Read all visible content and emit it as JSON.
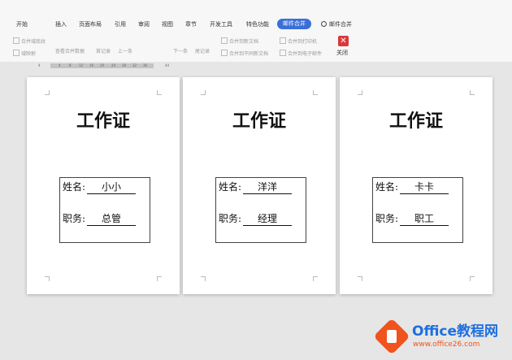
{
  "menu": {
    "items": [
      "开始",
      "插入",
      "页面布局",
      "引用",
      "审阅",
      "视图",
      "章节",
      "开发工具",
      "特色功能"
    ],
    "active": "邮件合并",
    "search": "邮件合并"
  },
  "toolbar": {
    "btn1": "合并域底纹",
    "btn2": "域映射",
    "btn3": "查看合并数据",
    "btn4": "首记录",
    "btn5": "上一条",
    "btn6": "下一条",
    "btn7": "尾记录",
    "btn8": "合并到新文档",
    "btn9": "合并到不同新文档",
    "btn10": "合并到打印机",
    "btn11": "合并到电子邮件",
    "close": "关闭",
    "close_glyph": "✕"
  },
  "ruler": {
    "ticks": [
      "4",
      "4",
      "8",
      "12",
      "16",
      "20",
      "24",
      "28",
      "32",
      "36",
      "44"
    ]
  },
  "cards": [
    {
      "title": "工作证",
      "name_label": "姓名:",
      "name": "小小",
      "job_label": "职务:",
      "job": "总管"
    },
    {
      "title": "工作证",
      "name_label": "姓名:",
      "name": "洋洋",
      "job_label": "职务:",
      "job": "经理"
    },
    {
      "title": "工作证",
      "name_label": "姓名:",
      "name": "卡卡",
      "job_label": "职务:",
      "job": "职工"
    }
  ],
  "watermark": {
    "brand": "Office教程网",
    "url": "www.office26.com"
  },
  "colors": {
    "accent": "#3a6fd8",
    "close": "#d9383a",
    "brand_orange": "#f0531d",
    "brand_blue": "#1e6fe0"
  },
  "icons": [
    "search-icon",
    "close-icon",
    "office-logo-icon"
  ]
}
